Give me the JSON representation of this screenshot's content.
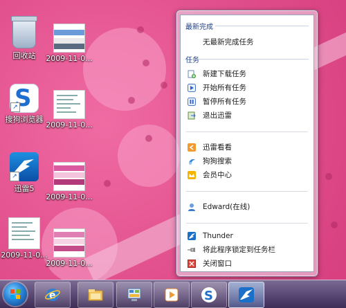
{
  "desktop": {
    "icons": [
      {
        "label": "回收站"
      },
      {
        "label": "2009-11-0..."
      },
      {
        "label": "搜狗浏览器"
      },
      {
        "label": "2009-11-0..."
      },
      {
        "label": "迅雷5"
      },
      {
        "label": "2009-11-0..."
      },
      {
        "label": "2009-11-0..."
      },
      {
        "label": "2009-11-0..."
      }
    ]
  },
  "jumplist": {
    "recent_header": "最新完成",
    "recent_empty": "无最新完成任务",
    "tasks_header": "任务",
    "tasks": [
      {
        "label": "新建下载任务",
        "icon": "new-download-icon"
      },
      {
        "label": "开始所有任务",
        "icon": "play-icon"
      },
      {
        "label": "暂停所有任务",
        "icon": "pause-icon"
      },
      {
        "label": "退出迅雷",
        "icon": "exit-icon"
      }
    ],
    "links": [
      {
        "label": "迅雷看看",
        "icon": "kankan-icon"
      },
      {
        "label": "狗狗搜索",
        "icon": "gougou-icon"
      },
      {
        "label": "会员中心",
        "icon": "vip-icon"
      }
    ],
    "user": {
      "label": "Edward(在线)",
      "icon": "user-icon"
    },
    "app": {
      "label": "Thunder",
      "icon": "thunder-icon"
    },
    "pin": {
      "label": "将此程序锁定到任务栏",
      "icon": "pin-icon"
    },
    "close": {
      "label": "关闭窗口",
      "icon": "close-icon"
    }
  },
  "taskbar": {
    "buttons": [
      {
        "name": "ie-icon"
      },
      {
        "name": "explorer-icon"
      },
      {
        "name": "control-panel-icon"
      },
      {
        "name": "media-player-icon"
      },
      {
        "name": "sogou-icon"
      },
      {
        "name": "thunder-icon"
      }
    ]
  },
  "colors": {
    "wallpaper": "#e14f8c",
    "header_text": "#1f3f82",
    "taskbar": "#5f4d79"
  }
}
